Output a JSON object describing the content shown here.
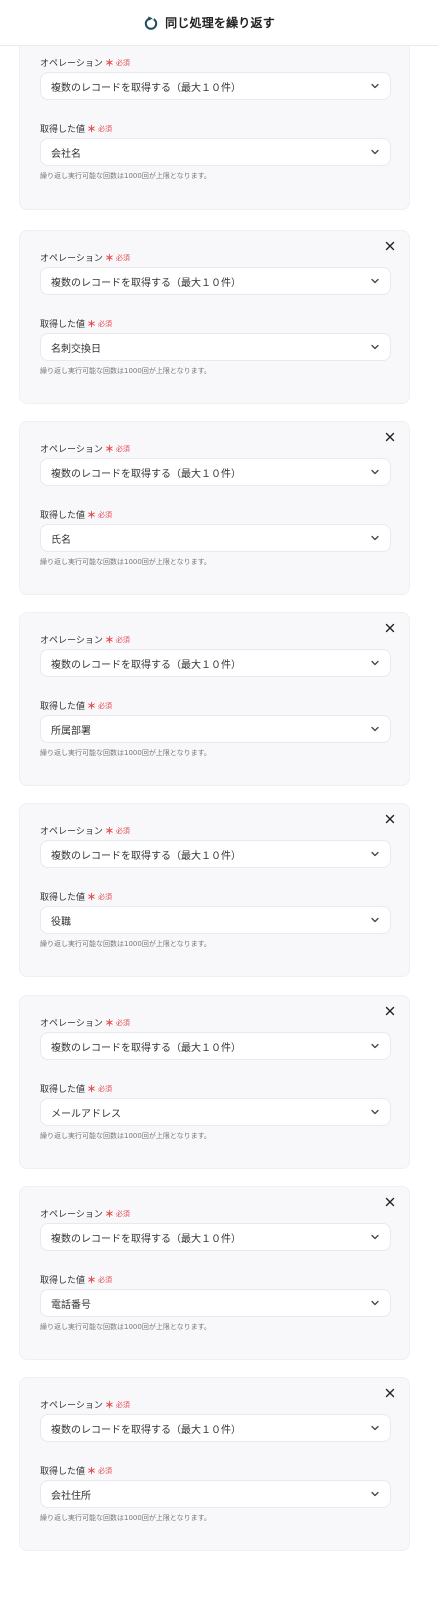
{
  "header": {
    "title": "同じ処理を繰り返す",
    "icon": "refresh-icon",
    "accent": "#1f4e5a"
  },
  "labels": {
    "operation": "オペレーション",
    "value": "取得した値",
    "required_mark": "＊",
    "required_text": "必須",
    "hint": "繰り返し実行可能な回数は1000回が上限となります。"
  },
  "colors": {
    "required": "#e5484d",
    "card_bg": "#f8f8fb"
  },
  "cards": [
    {
      "operation": "複数のレコードを取得する（最大１０件）",
      "value": "会社名",
      "closable": false
    },
    {
      "operation": "複数のレコードを取得する（最大１０件）",
      "value": "名刺交換日",
      "closable": true
    },
    {
      "operation": "複数のレコードを取得する（最大１０件）",
      "value": "氏名",
      "closable": true
    },
    {
      "operation": "複数のレコードを取得する（最大１０件）",
      "value": "所属部署",
      "closable": true
    },
    {
      "operation": "複数のレコードを取得する（最大１０件）",
      "value": "役職",
      "closable": true
    },
    {
      "operation": "複数のレコードを取得する（最大１０件）",
      "value": "メールアドレス",
      "closable": true
    },
    {
      "operation": "複数のレコードを取得する（最大１０件）",
      "value": "電話番号",
      "closable": true
    },
    {
      "operation": "複数のレコードを取得する（最大１０件）",
      "value": "会社住所",
      "closable": true
    }
  ]
}
